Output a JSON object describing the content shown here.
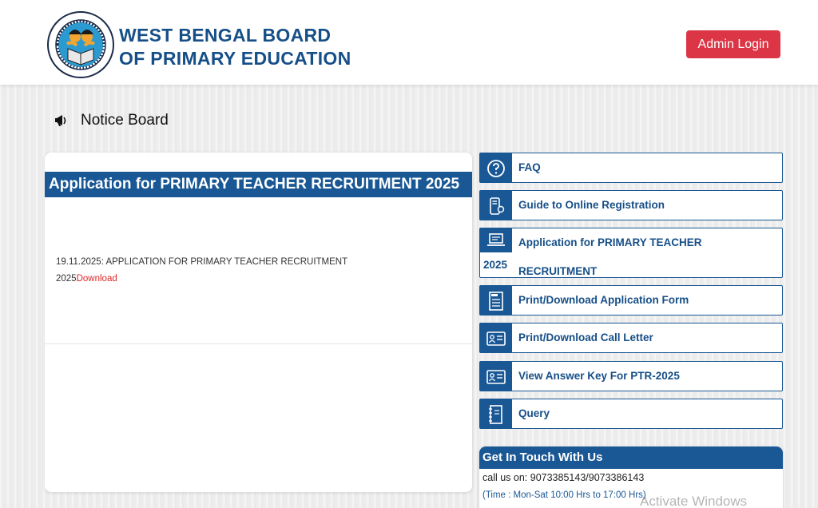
{
  "header": {
    "brand_line1": "WEST BENGAL BOARD",
    "brand_line2": "OF PRIMARY EDUCATION",
    "admin_login": "Admin Login",
    "logo_icon": "wbbpe-seal-icon"
  },
  "notice_board": {
    "title": "Notice Board",
    "card_heading": "Application for PRIMARY TEACHER RECRUITMENT 2025",
    "notice_text": "19.11.2025: APPLICATION FOR PRIMARY TEACHER RECRUITMENT 2025",
    "download_label": "Download"
  },
  "links": [
    {
      "label": "FAQ",
      "icon": "question-icon"
    },
    {
      "label": "Guide to Online Registration",
      "icon": "mobile-guide-icon"
    },
    {
      "label": "Application for PRIMARY TEACHER RECRUITMENT",
      "label_cont": "2025",
      "icon": "laptop-icon"
    },
    {
      "label": "Print/Download Application Form",
      "icon": "form-icon"
    },
    {
      "label": "Print/Download Call Letter",
      "icon": "id-card-icon"
    },
    {
      "label": "View Answer Key For PTR-2025",
      "icon": "id-card-icon"
    },
    {
      "label": "Query",
      "icon": "notebook-icon"
    }
  ],
  "contact": {
    "heading": "Get In Touch With Us",
    "phone": "call us on: 9073385143/9073386143",
    "hours": "(Time : Mon-Sat 10:00 Hrs to 17:00 Hrs)"
  },
  "watermark": "Activate Windows",
  "colors": {
    "primary": "#1a5895",
    "brand_text": "#164f88",
    "danger": "#dc3545",
    "download_link": "#dc2626"
  }
}
